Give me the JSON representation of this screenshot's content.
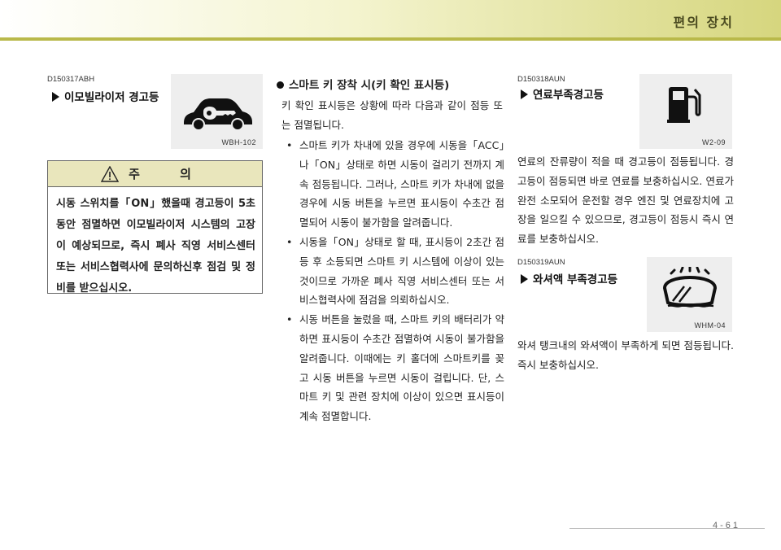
{
  "header": {
    "title": "편의 장치"
  },
  "left": {
    "code": "D150317ABH",
    "title": "이모빌라이저 경고등",
    "image_caption": "WBH-102",
    "icon": "car-key-icon",
    "caution": {
      "title": "주 의",
      "text": "시동 스위치를「ON」했을때 경고등이 5초동안 점멸하면 이모빌라이저 시스템의 고장이 예상되므로, 즉시 폐사 직영 서비스센터 또는 서비스협력사에 문의하신후 점검 및 정비를 받으십시오."
    }
  },
  "middle": {
    "title": "스마트 키 장착 시(키 확인 표시등)",
    "intro": "키 확인 표시등은 상황에 따라 다음과 같이 점등 또는 점멸됩니다.",
    "bullets": [
      "스마트 키가 차내에 있을 경우에 시동을「ACC」나「ON」상태로 하면 시동이 걸리기 전까지 계속 점등됩니다. 그러나, 스마트 키가 차내에 없을 경우에 시동 버튼을 누르면 표시등이 수초간 점멸되어 시동이 불가함을 알려줍니다.",
      "시동을「ON」상태로 할 때, 표시등이 2초간 점등 후 소등되면 스마트 키 시스템에 이상이 있는 것이므로 가까운 폐사 직영 서비스센터 또는 서비스협력사에 점검을 의뢰하십시오.",
      "시동 버튼을 눌렀을 때, 스마트 키의 배터리가 약하면 표시등이 수초간 점멸하여 시동이 불가함을 알려줍니다. 이때에는 키 홀더에 스마트키를 꽂고 시동 버튼을 누르면 시동이 걸립니다. 단, 스마트 키 및 관련 장치에 이상이 있으면 표시등이 계속 점멸합니다."
    ]
  },
  "right": {
    "fuel": {
      "code": "D150318AUN",
      "title": "연료부족경고등",
      "image_caption": "W2-09",
      "icon": "fuel-pump-icon",
      "text": "연료의 잔류량이 적을 때 경고등이 점등됩니다. 경고등이 점등되면 바로 연료를 보충하십시오. 연료가 완전 소모되어 운전할 경우 엔진 및 연료장치에 고장을 일으킬 수 있으므로, 경고등이 점등시 즉시 연료를 보충하십시오."
    },
    "washer": {
      "code": "D150319AUN",
      "title": "와셔액 부족경고등",
      "image_caption": "WHM-04",
      "icon": "washer-fluid-icon",
      "text": "와셔 탱크내의 와셔액이 부족하게 되면 점등됩니다. 즉시 보충하십시오."
    }
  },
  "footer": {
    "page": "4-61"
  }
}
